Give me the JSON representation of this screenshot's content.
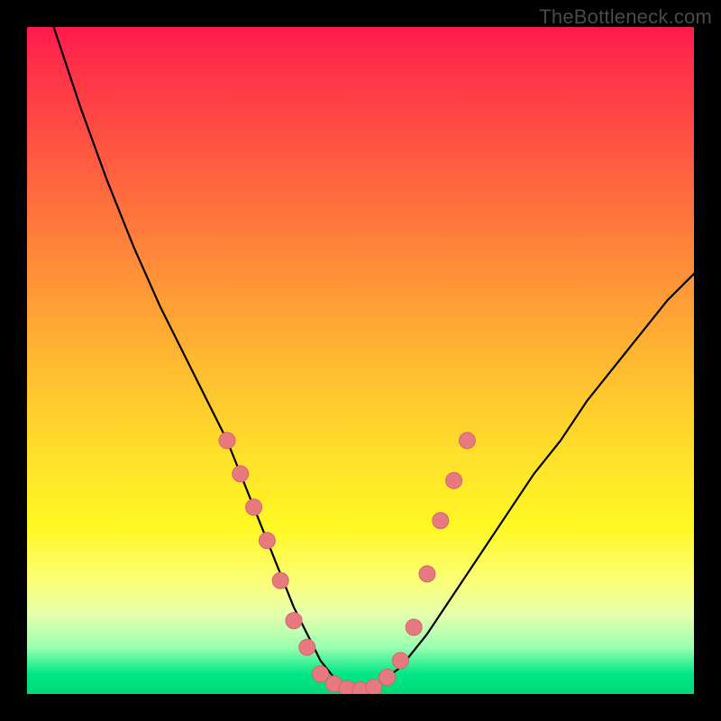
{
  "watermark": "TheBottleneck.com",
  "colors": {
    "background_frame": "#000000",
    "curve": "#000000",
    "marker_fill": "#e67a80",
    "marker_stroke": "#d9636b",
    "gradient_top": "#ff1a4d",
    "gradient_bottom": "#00d978"
  },
  "chart_data": {
    "type": "line",
    "title": "",
    "xlabel": "",
    "ylabel": "",
    "xlim": [
      0,
      100
    ],
    "ylim": [
      0,
      100
    ],
    "grid": false,
    "legend": false,
    "series": [
      {
        "name": "curve",
        "x": [
          4,
          8,
          12,
          16,
          20,
          24,
          28,
          30,
          32,
          34,
          36,
          38,
          40,
          42,
          44,
          46,
          48,
          50,
          52,
          56,
          60,
          64,
          68,
          72,
          76,
          80,
          84,
          88,
          92,
          96,
          100
        ],
        "y": [
          100,
          88,
          77,
          67,
          58,
          50,
          42,
          38,
          33,
          28,
          23,
          18,
          13,
          9,
          5,
          2.5,
          1,
          0.5,
          1,
          4,
          9,
          15,
          21,
          27,
          33,
          38,
          44,
          49,
          54,
          59,
          63
        ]
      }
    ],
    "markers": [
      {
        "x": 30,
        "y": 38
      },
      {
        "x": 32,
        "y": 33
      },
      {
        "x": 34,
        "y": 28
      },
      {
        "x": 36,
        "y": 23
      },
      {
        "x": 38,
        "y": 17
      },
      {
        "x": 40,
        "y": 11
      },
      {
        "x": 42,
        "y": 7
      },
      {
        "x": 44,
        "y": 3
      },
      {
        "x": 46,
        "y": 1.5
      },
      {
        "x": 48,
        "y": 0.8
      },
      {
        "x": 50,
        "y": 0.6
      },
      {
        "x": 52,
        "y": 1
      },
      {
        "x": 54,
        "y": 2.5
      },
      {
        "x": 56,
        "y": 5
      },
      {
        "x": 58,
        "y": 10
      },
      {
        "x": 60,
        "y": 18
      },
      {
        "x": 62,
        "y": 26
      },
      {
        "x": 64,
        "y": 32
      },
      {
        "x": 66,
        "y": 38
      }
    ],
    "marker_radius": 9
  }
}
